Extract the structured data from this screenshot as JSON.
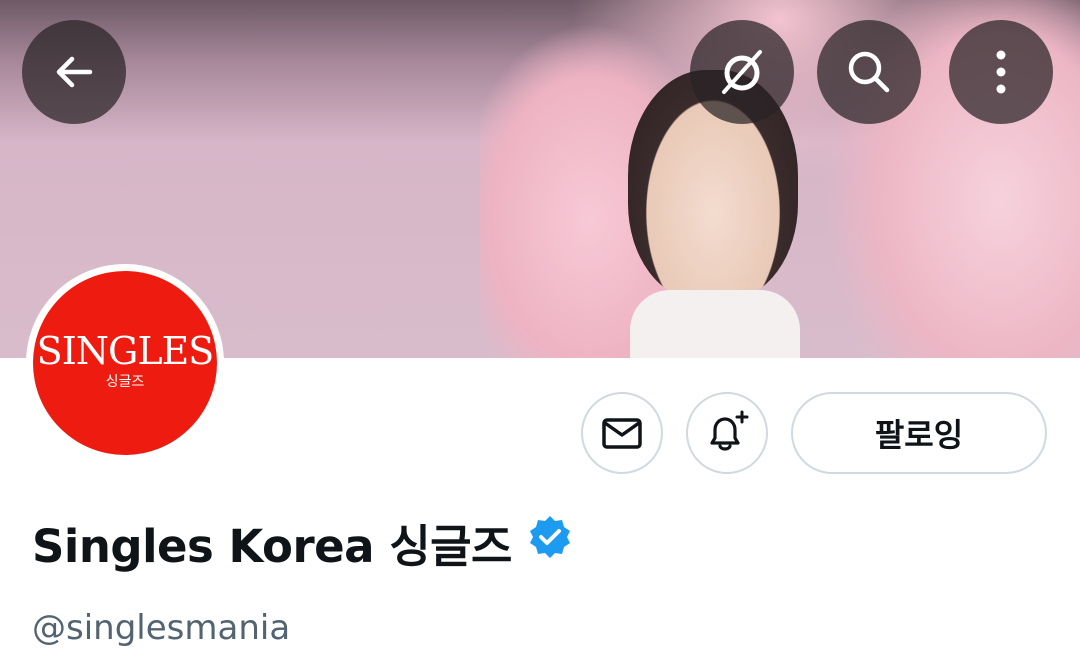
{
  "header": {
    "back_icon": "arrow-left-icon",
    "grok_icon": "slashed-circle-icon",
    "search_icon": "search-icon",
    "more_icon": "more-vertical-icon"
  },
  "profile": {
    "avatar_logo": "SINGLES",
    "avatar_subtitle": "싱글즈",
    "display_name": "Singles Korea 싱글즈",
    "verified": true,
    "handle": "@singlesmania",
    "follow_label": "팔로잉"
  },
  "actions": {
    "message_icon": "envelope-icon",
    "notify_icon": "bell-plus-icon"
  },
  "colors": {
    "avatar_bg": "#ee1c10",
    "verified_badge": "#1d9bf0",
    "text_primary": "#0f1419",
    "text_secondary": "#536471",
    "border": "#cfd9de"
  }
}
